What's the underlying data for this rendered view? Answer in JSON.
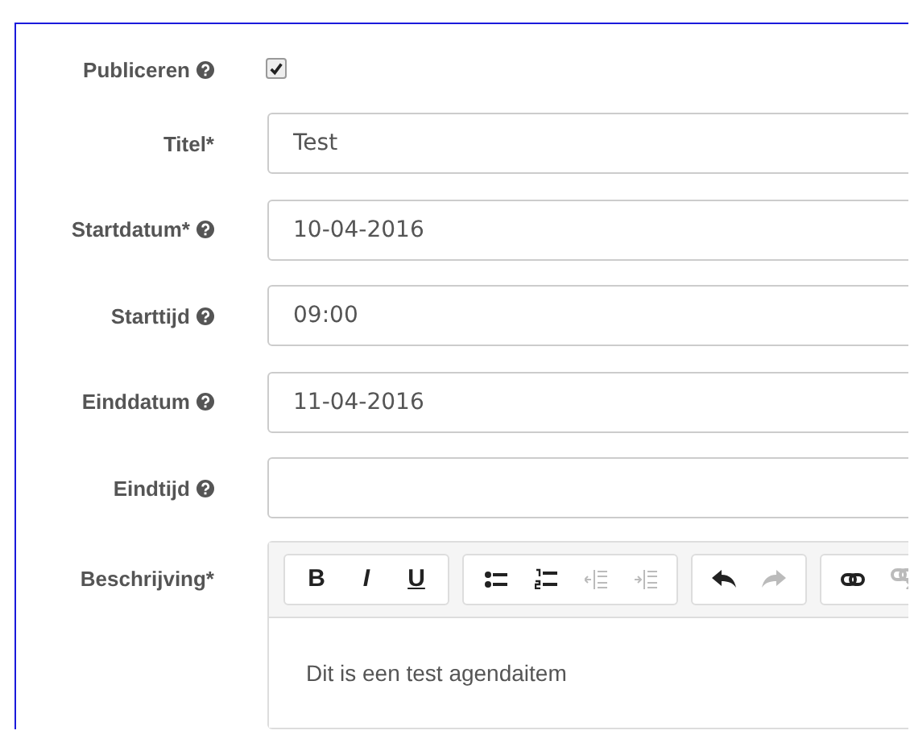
{
  "publish": {
    "label": "Publiceren",
    "help": true,
    "checked": true
  },
  "fields": [
    {
      "label": "Titel*",
      "help": false,
      "value": "Test"
    },
    {
      "label": "Startdatum*",
      "help": true,
      "value": "10-04-2016"
    },
    {
      "label": "Starttijd",
      "help": true,
      "value": "09:00"
    },
    {
      "label": "Einddatum",
      "help": true,
      "value": "11-04-2016"
    },
    {
      "label": "Eindtijd",
      "help": true
    }
  ],
  "description": {
    "label": "Beschrijving*",
    "toolbar": [
      [
        {
          "kind": "bold",
          "text": "B",
          "disabled": false
        },
        {
          "kind": "italic",
          "text": "I",
          "disabled": false
        },
        {
          "kind": "underline",
          "text": "U",
          "disabled": false
        }
      ],
      [
        {
          "kind": "bullets",
          "disabled": false
        },
        {
          "kind": "numbers",
          "disabled": false
        },
        {
          "kind": "outdent",
          "disabled": true
        },
        {
          "kind": "indent",
          "disabled": true
        }
      ],
      [
        {
          "kind": "undo",
          "disabled": false
        },
        {
          "kind": "redo",
          "disabled": true
        }
      ],
      [
        {
          "kind": "link",
          "disabled": false
        },
        {
          "kind": "unlink",
          "disabled": true
        }
      ]
    ],
    "text": "Dit is een test agendaitem"
  }
}
